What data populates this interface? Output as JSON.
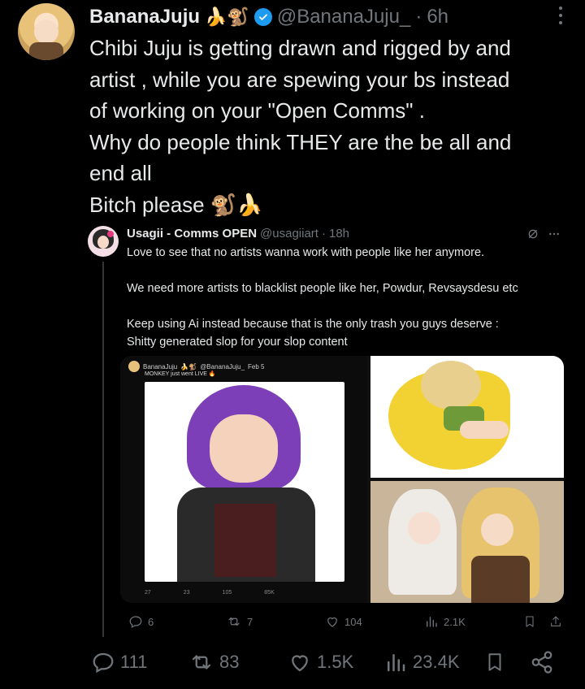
{
  "tweet": {
    "author_name": "BananaJuju",
    "name_emojis": "🍌🐒",
    "handle": "@BananaJuju_",
    "separator": "·",
    "time": "6h",
    "text_lines": [
      "Chibi Juju is getting drawn and rigged by and",
      "artist , while you are spewing your bs instead",
      "of working on your \"Open Comms\" .",
      "Why do people think THEY are the be all and",
      "end all",
      "Bitch please  🐒🍌"
    ],
    "stats": {
      "replies": "111",
      "reposts": "83",
      "likes": "1.5K",
      "views": "23.4K"
    }
  },
  "quote": {
    "author_name": "Usagii - Comms OPEN",
    "handle": "@usagiiart",
    "separator": "·",
    "time": "18h",
    "text_lines": [
      "Love to see that no artists wanna work with people like her anymore.",
      "",
      "We need more artists to blacklist people like her, Powdur, Revsaysdesu etc",
      "",
      "Keep using Ai instead because that is the only trash you guys deserve :",
      "Shitty generated slop for your slop content"
    ],
    "embedded": {
      "author_name": "BananaJuju",
      "name_emojis": "🍌🐒",
      "handle": "@BananaJuju_",
      "time": "Feb 5",
      "text": "MONKEY just went LIVE 🔥",
      "stats": [
        "27",
        "23",
        "105",
        "85K"
      ]
    },
    "stats": {
      "replies": "6",
      "reposts": "7",
      "likes": "104",
      "views": "2.1K"
    }
  },
  "colors": {
    "background": "#000000",
    "text": "#e7e9ea",
    "muted": "#71767b",
    "verified": "#1d9bf0",
    "divider": "#333639"
  },
  "icons": [
    "verified-icon",
    "more-icon",
    "grok-icon",
    "reply-icon",
    "repost-icon",
    "like-icon",
    "views-icon",
    "bookmark-icon",
    "share-icon"
  ]
}
